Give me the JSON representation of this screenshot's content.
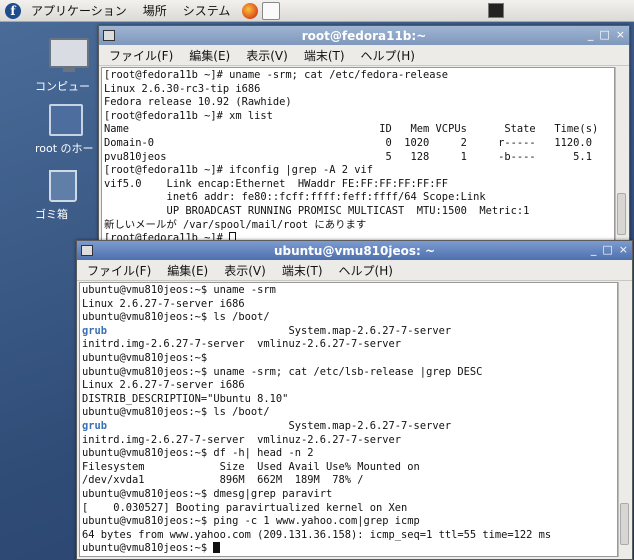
{
  "panel": {
    "logo": "f",
    "menus": [
      "アプリケーション",
      "場所",
      "システム"
    ]
  },
  "desktop": {
    "icons": [
      {
        "label": "コンピュー",
        "icon": "computer-icon"
      },
      {
        "label": "root のホー",
        "icon": "home-folder-icon"
      },
      {
        "label": "ゴミ箱",
        "icon": "trash-icon"
      }
    ]
  },
  "win1": {
    "title": "root@fedora11b:~",
    "controls": [
      "_",
      "□",
      "×"
    ],
    "menus": [
      "ファイル(F)",
      "編集(E)",
      "表示(V)",
      "端末(T)",
      "ヘルプ(H)"
    ],
    "lines": [
      "[root@fedora11b ~]# uname -srm; cat /etc/fedora-release",
      "Linux 2.6.30-rc3-tip i686",
      "Fedora release 10.92 (Rawhide)",
      "[root@fedora11b ~]# xm list",
      "Name                                        ID   Mem VCPUs      State   Time(s)",
      "Domain-0                                     0  1020     2     r-----   1120.0",
      "pvu810jeos                                   5   128     1     -b----      5.1",
      "[root@fedora11b ~]# ifconfig |grep -A 2 vif",
      "vif5.0    Link encap:Ethernet  HWaddr FE:FF:FF:FF:FF:FF",
      "          inet6 addr: fe80::fcff:ffff:feff:ffff/64 Scope:Link",
      "          UP BROADCAST RUNNING PROMISC MULTICAST  MTU:1500  Metric:1",
      "新しいメールが /var/spool/mail/root にあります"
    ],
    "prompt": "[root@fedora11b ~]# "
  },
  "win2": {
    "title": "ubuntu@vmu810jeos: ~",
    "controls": [
      "_",
      "□",
      "×"
    ],
    "menus": [
      "ファイル(F)",
      "編集(E)",
      "表示(V)",
      "端末(T)",
      "ヘルプ(H)"
    ],
    "lines": [
      "ubuntu@vmu810jeos:~$ uname -srm",
      "Linux 2.6.27-7-server i686",
      "ubuntu@vmu810jeos:~$ ls /boot/",
      {
        "dir": "grub",
        "rest": "                             System.map-2.6.27-7-server"
      },
      "initrd.img-2.6.27-7-server  vmlinuz-2.6.27-7-server",
      "ubuntu@vmu810jeos:~$",
      "ubuntu@vmu810jeos:~$ uname -srm; cat /etc/lsb-release |grep DESC",
      "Linux 2.6.27-7-server i686",
      "DISTRIB_DESCRIPTION=\"Ubuntu 8.10\"",
      "ubuntu@vmu810jeos:~$ ls /boot/",
      {
        "dir": "grub",
        "rest": "                             System.map-2.6.27-7-server"
      },
      "initrd.img-2.6.27-7-server  vmlinuz-2.6.27-7-server",
      "ubuntu@vmu810jeos:~$ df -h| head -n 2",
      "Filesystem            Size  Used Avail Use% Mounted on",
      "/dev/xvda1            896M  662M  189M  78% /",
      "ubuntu@vmu810jeos:~$ dmesg|grep paravirt",
      "[    0.030527] Booting paravirtualized kernel on Xen",
      "ubuntu@vmu810jeos:~$ ping -c 1 www.yahoo.com|grep icmp",
      "64 bytes from www.yahoo.com (209.131.36.158): icmp_seq=1 ttl=55 time=122 ms"
    ],
    "prompt": "ubuntu@vmu810jeos:~$ "
  }
}
